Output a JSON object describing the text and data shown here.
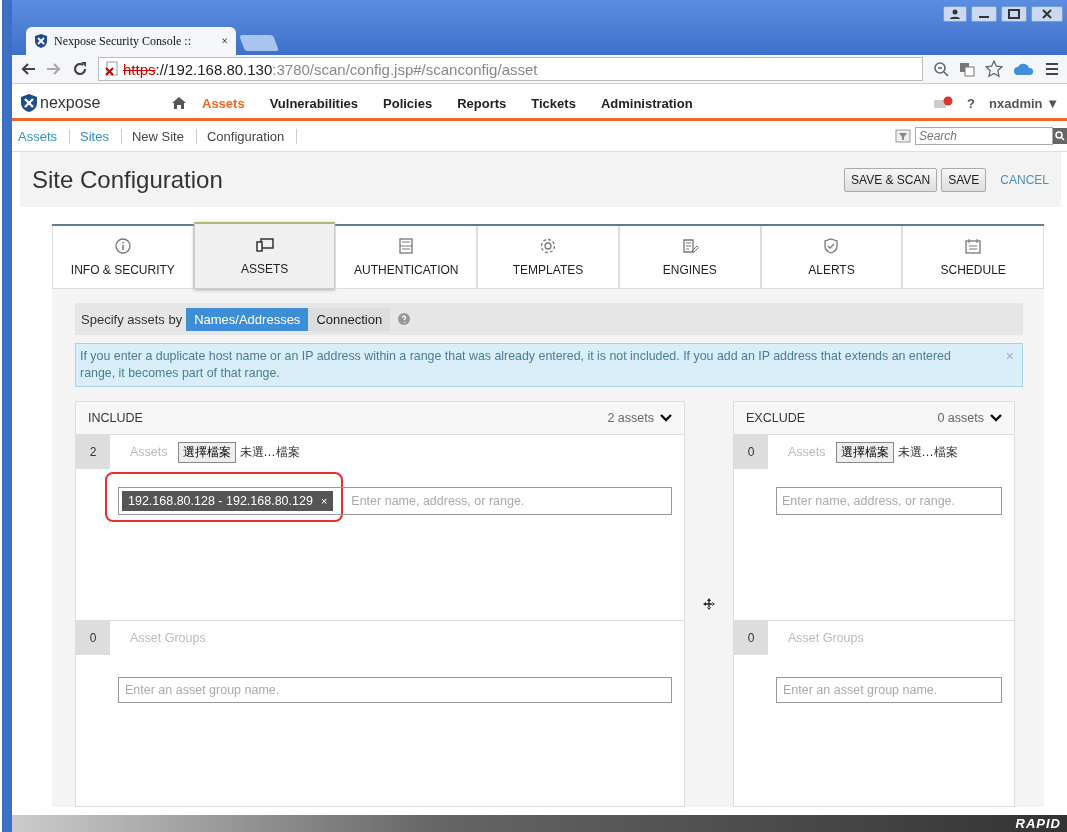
{
  "browser": {
    "tab_title": "Nexpose Security Console ::",
    "tab_close": "×",
    "url": {
      "scheme": "https",
      "host": "://192.168.80.130",
      "path": ":3780/scan/config.jsp#/scanconfig/asset"
    }
  },
  "app": {
    "logo": "nexpose",
    "nav": [
      {
        "label": "Assets",
        "selected": true
      },
      {
        "label": "Vulnerabilities",
        "selected": false
      },
      {
        "label": "Policies",
        "selected": false
      },
      {
        "label": "Reports",
        "selected": false
      },
      {
        "label": "Tickets",
        "selected": false
      },
      {
        "label": "Administration",
        "selected": false
      }
    ],
    "help": "?",
    "user": "nxadmin ▼"
  },
  "breadcrumb": [
    {
      "label": "Assets",
      "kind": "link"
    },
    {
      "label": "Sites",
      "kind": "link"
    },
    {
      "label": "New Site",
      "kind": "text"
    },
    {
      "label": "Configuration",
      "kind": "text"
    }
  ],
  "search": {
    "placeholder": "Search"
  },
  "page": {
    "title": "Site Configuration",
    "buttons": [
      {
        "label": "SAVE & SCAN",
        "kind": "button"
      },
      {
        "label": "SAVE",
        "kind": "button"
      },
      {
        "label": "CANCEL",
        "kind": "link"
      }
    ]
  },
  "tabs": [
    {
      "label": "INFO & SECURITY",
      "selected": false
    },
    {
      "label": "ASSETS",
      "selected": true
    },
    {
      "label": "AUTHENTICATION",
      "selected": false
    },
    {
      "label": "TEMPLATES",
      "selected": false
    },
    {
      "label": "ENGINES",
      "selected": false
    },
    {
      "label": "ALERTS",
      "selected": false
    },
    {
      "label": "SCHEDULE",
      "selected": false
    }
  ],
  "specify": {
    "label": "Specify assets by",
    "options": [
      {
        "label": "Names/Addresses",
        "selected": true
      },
      {
        "label": "Connection",
        "selected": false
      }
    ]
  },
  "notice": {
    "text": "If you enter a duplicate host name or an IP address within a range that was already entered, it is not included. If you add an IP address that extends an entered range, it becomes part of that range.",
    "close": "×"
  },
  "panels": [
    {
      "title": "INCLUDE",
      "count_label": "2 assets",
      "assets": {
        "count": "2",
        "label": "Assets",
        "file_button": "選擇檔案",
        "file_status": "未選…檔案",
        "highlighted": true,
        "tags": [
          {
            "label": "192.168.80.128 - 192.168.80.129",
            "remove": "×"
          }
        ],
        "placeholder": "Enter name, address, or range."
      },
      "groups": {
        "count": "0",
        "label": "Asset Groups",
        "placeholder": "Enter an asset group name."
      }
    },
    {
      "title": "EXCLUDE",
      "count_label": "0 assets",
      "assets": {
        "count": "0",
        "label": "Assets",
        "file_button": "選擇檔案",
        "file_status": "未選…檔案",
        "highlighted": false,
        "placeholder": "Enter name, address, or range."
      },
      "groups": {
        "count": "0",
        "label": "Asset Groups",
        "placeholder": "Enter an asset group name."
      }
    }
  ],
  "footer": {
    "logo": "RAPID"
  }
}
